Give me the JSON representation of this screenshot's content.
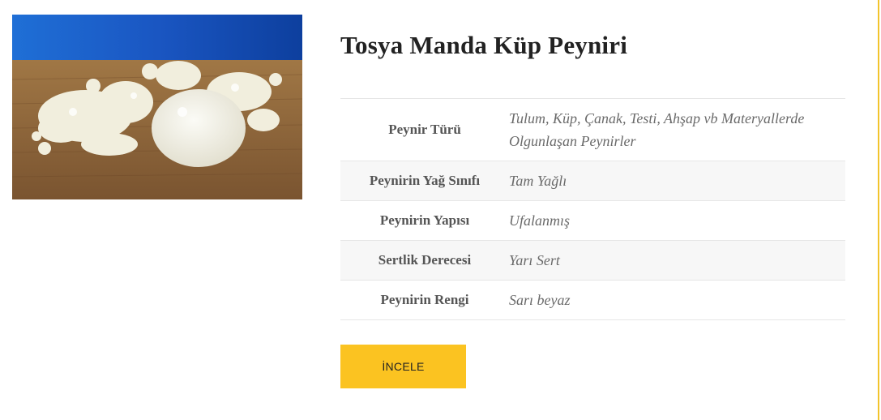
{
  "product": {
    "title": "Tosya Manda Küp Peyniri",
    "image_alt": "Tosya Manda Küp Peyniri"
  },
  "specs": [
    {
      "label": "Peynir Türü",
      "value": "Tulum, Küp, Çanak, Testi, Ahşap vb Materyallerde Olgunlaşan Peynirler"
    },
    {
      "label": "Peynirin Yağ Sınıfı",
      "value": "Tam Yağlı"
    },
    {
      "label": "Peynirin Yapısı",
      "value": "Ufalanmış"
    },
    {
      "label": "Sertlik Derecesi",
      "value": "Yarı Sert"
    },
    {
      "label": "Peynirin Rengi",
      "value": "Sarı beyaz"
    }
  ],
  "cta": {
    "label": "İNCELE"
  },
  "colors": {
    "accent": "#fbc321",
    "title": "#222222",
    "spec_label": "#555555",
    "spec_value": "#6a6a6a"
  }
}
